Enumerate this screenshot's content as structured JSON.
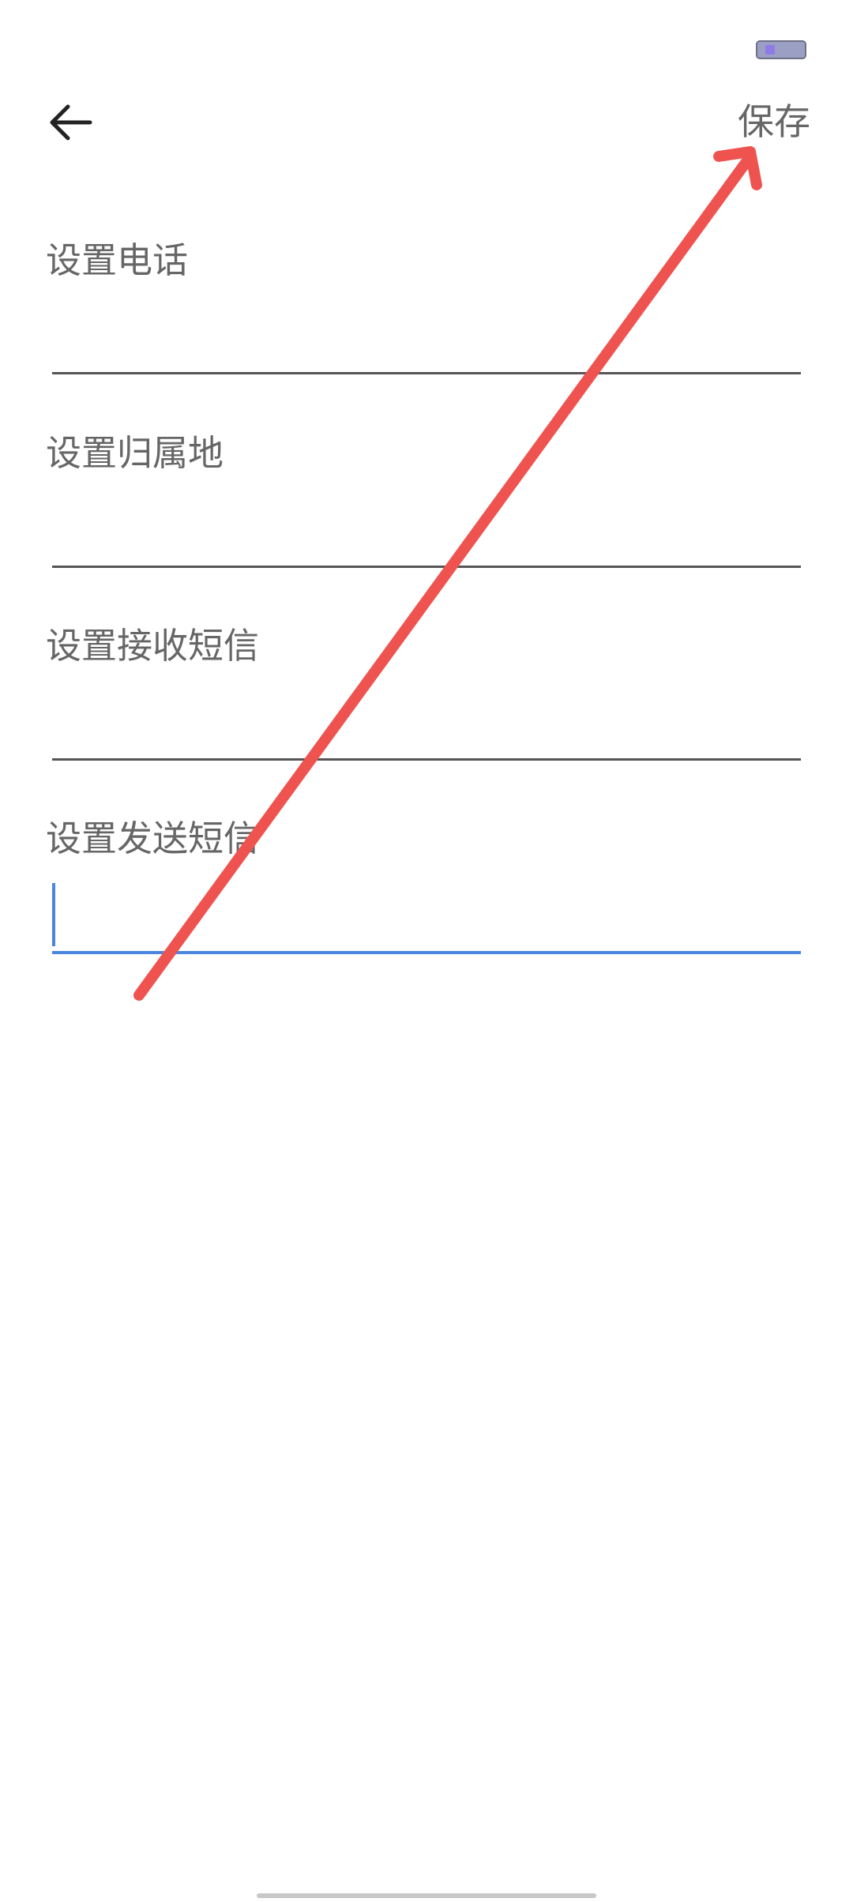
{
  "header": {
    "back_icon": "arrow-left-icon",
    "save_label": "保存"
  },
  "fields": [
    {
      "label": "设置电话",
      "value": "",
      "focused": false
    },
    {
      "label": "设置归属地",
      "value": "",
      "focused": false
    },
    {
      "label": "设置接收短信",
      "value": "",
      "focused": false
    },
    {
      "label": "设置发送短信",
      "value": "",
      "focused": true
    }
  ],
  "colors": {
    "accent": "#4a86e0",
    "annotation_arrow": "#ef5350",
    "label_text": "#666666",
    "underline": "#555555"
  },
  "status_bar": {
    "battery_icon": "battery-icon"
  },
  "annotation": {
    "icon": "red-arrow-annotation-icon"
  }
}
